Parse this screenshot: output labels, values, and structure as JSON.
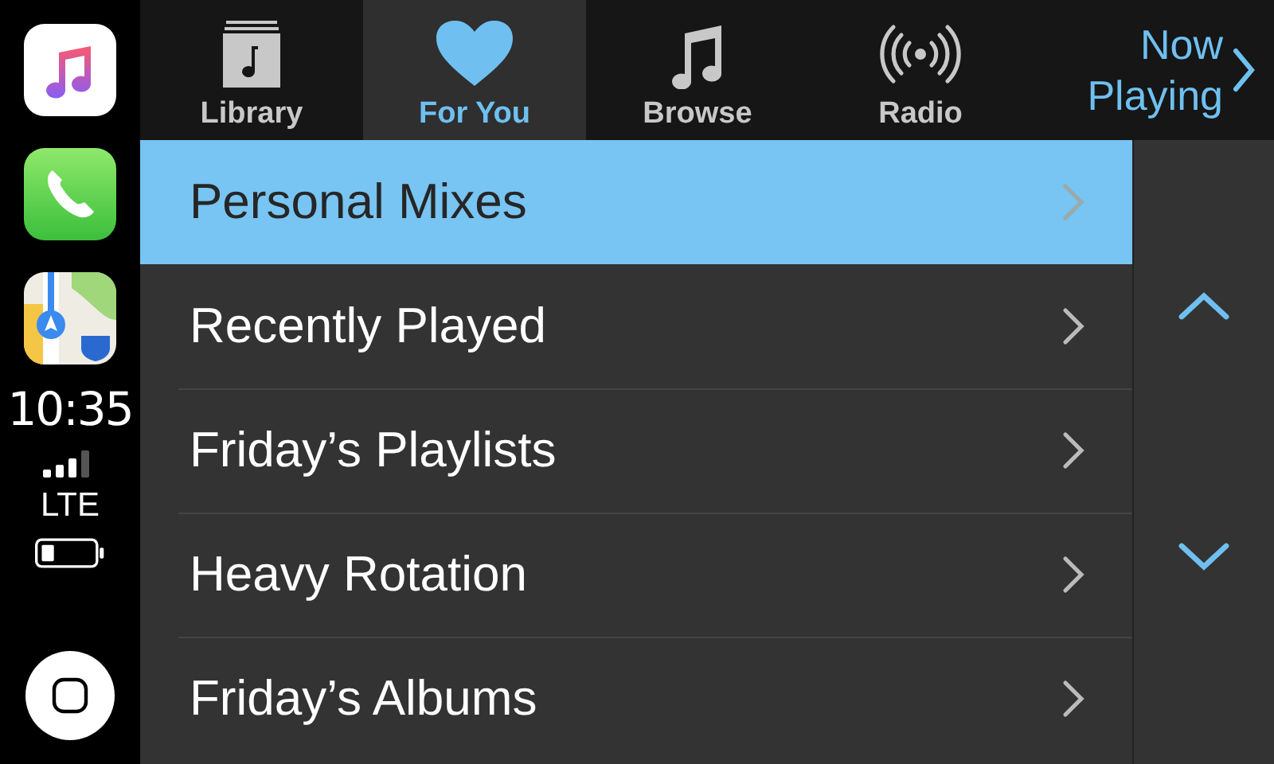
{
  "sidebar": {
    "apps": [
      {
        "kind": "music"
      },
      {
        "kind": "phone"
      },
      {
        "kind": "maps"
      }
    ],
    "time": "10:35",
    "network": "LTE"
  },
  "tabs": [
    {
      "label": "Library",
      "kind": "library",
      "selected": false
    },
    {
      "label": "For You",
      "kind": "heart",
      "selected": true
    },
    {
      "label": "Browse",
      "kind": "note",
      "selected": false
    },
    {
      "label": "Radio",
      "kind": "radio",
      "selected": false
    }
  ],
  "now_playing": {
    "label": "Now Playing"
  },
  "list": {
    "items": [
      {
        "label": "Personal Mixes",
        "selected": true
      },
      {
        "label": "Recently Played",
        "selected": false
      },
      {
        "label": "Friday’s Playlists",
        "selected": false
      },
      {
        "label": "Heavy Rotation",
        "selected": false
      },
      {
        "label": "Friday’s Albums",
        "selected": false
      }
    ]
  }
}
